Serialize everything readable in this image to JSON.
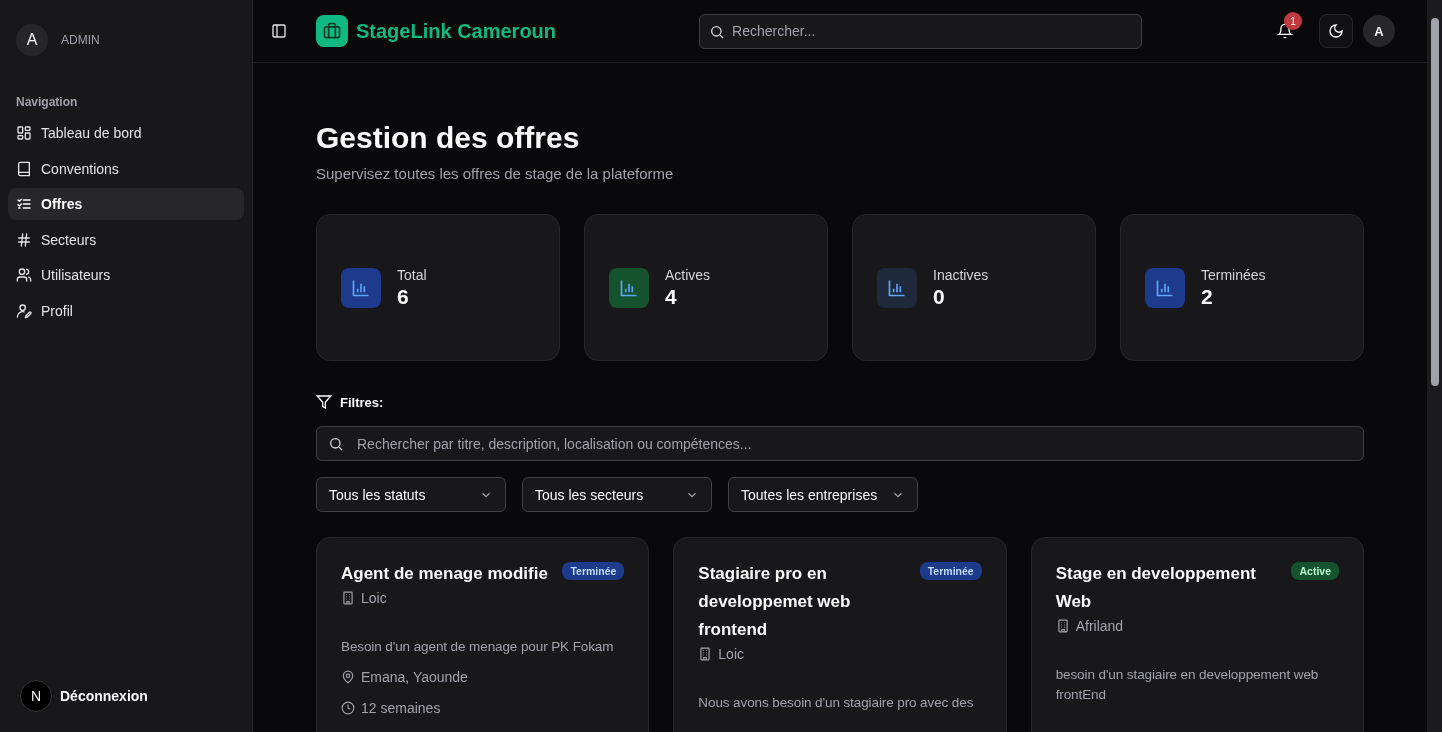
{
  "sidebar": {
    "user": {
      "initial": "A",
      "role": "ADMIN"
    },
    "section_title": "Navigation",
    "items": [
      {
        "label": "Tableau de bord",
        "selected": false
      },
      {
        "label": "Conventions",
        "selected": false
      },
      {
        "label": "Offres",
        "selected": true
      },
      {
        "label": "Secteurs",
        "selected": false
      },
      {
        "label": "Utilisateurs",
        "selected": false
      },
      {
        "label": "Profil",
        "selected": false
      }
    ],
    "footer": {
      "initial": "N",
      "label": "Déconnexion"
    }
  },
  "header": {
    "brand": "StageLink Cameroun",
    "search": {
      "placeholder": "Rechercher..."
    },
    "notification_count": "1",
    "avatar": "A"
  },
  "page": {
    "title": "Gestion des offres",
    "subtitle": "Supervisez toutes les offres de stage de la plateforme"
  },
  "stats": [
    {
      "label": "Total",
      "value": "6",
      "color": "#1e3a8a"
    },
    {
      "label": "Actives",
      "value": "4",
      "color": "#14532d"
    },
    {
      "label": "Inactives",
      "value": "0",
      "color": "#1e293b"
    },
    {
      "label": "Terminées",
      "value": "2",
      "color": "#1e3a8a"
    }
  ],
  "filters": {
    "title": "Filtres:",
    "search": {
      "placeholder": "Rechercher par titre, description, localisation ou compétences..."
    },
    "selects": [
      "Tous les statuts",
      "Tous les secteurs",
      "Toutes les entreprises"
    ]
  },
  "offers": [
    {
      "title": "Agent de menage modifie",
      "status": {
        "label": "Terminée",
        "kind": "ended"
      },
      "company": "Loic",
      "description": "Besoin d'un agent de menage pour PK Fokam",
      "location": "Emana, Yaounde",
      "duration": "12 semaines"
    },
    {
      "title": "Stagiaire pro en developpemet web frontend",
      "status": {
        "label": "Terminée",
        "kind": "ended"
      },
      "company": "Loic",
      "description": "Nous avons besoin d'un stagiaire pro avec des"
    },
    {
      "title": "Stage en developpement Web",
      "status": {
        "label": "Active",
        "kind": "active"
      },
      "company": "Afriland",
      "description": "besoin d'un stagiaire en developpement web frontEnd"
    }
  ]
}
